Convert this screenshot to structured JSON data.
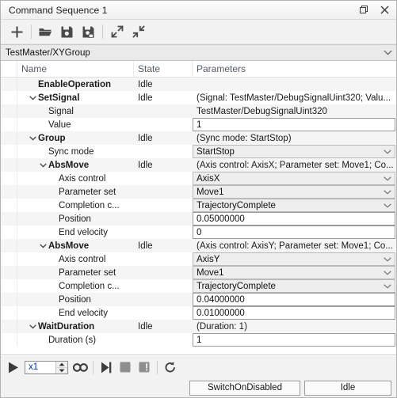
{
  "window": {
    "title": "Command Sequence 1",
    "restore_icon": "restore-window-icon",
    "close_icon": "close-icon"
  },
  "toolbar": {
    "buttons": [
      {
        "name": "add-command-button",
        "icon": "plus-icon",
        "label": "Add"
      },
      {
        "name": "open-sequence-button",
        "icon": "folder-open-icon",
        "label": "Open"
      },
      {
        "name": "save-sequence-button",
        "icon": "save-icon",
        "label": "Save"
      },
      {
        "name": "save-as-sequence-button",
        "icon": "save-as-icon",
        "label": "Save As"
      },
      {
        "name": "expand-all-button",
        "icon": "expand-arrows-icon",
        "label": "Expand All"
      },
      {
        "name": "collapse-all-button",
        "icon": "collapse-arrows-icon",
        "label": "Collapse All"
      }
    ]
  },
  "pathbar": {
    "value": "TestMaster/XYGroup",
    "chevron_icon": "chevron-down-icon"
  },
  "table": {
    "headers": [
      "Name",
      "State",
      "Parameters"
    ],
    "rows": [
      {
        "name": "EnableOperation",
        "indent": 0,
        "bold": true,
        "expander": "none",
        "state": "Idle",
        "param_kind": "text",
        "param": ""
      },
      {
        "name": "SetSignal",
        "indent": 0,
        "bold": true,
        "expander": "expanded",
        "state": "Idle",
        "param_kind": "text",
        "param": "(Signal: TestMaster/DebugSignalUint320; Valu..."
      },
      {
        "name": "Signal",
        "indent": 1,
        "bold": false,
        "expander": "none",
        "state": "",
        "param_kind": "text",
        "param": "TestMaster/DebugSignalUint320"
      },
      {
        "name": "Value",
        "indent": 1,
        "bold": false,
        "expander": "none",
        "state": "",
        "param_kind": "input",
        "param": "1"
      },
      {
        "name": "Group",
        "indent": 0,
        "bold": true,
        "expander": "expanded",
        "state": "Idle",
        "param_kind": "text",
        "param": "(Sync mode: StartStop)"
      },
      {
        "name": "Sync mode",
        "indent": 1,
        "bold": false,
        "expander": "none",
        "state": "",
        "param_kind": "combo",
        "param": "StartStop"
      },
      {
        "name": "AbsMove",
        "indent": 1,
        "bold": true,
        "expander": "expanded",
        "state": "Idle",
        "param_kind": "text",
        "param": "(Axis control: AxisX; Parameter set: Move1; Co..."
      },
      {
        "name": "Axis control",
        "indent": 2,
        "bold": false,
        "expander": "none",
        "state": "",
        "param_kind": "combo",
        "param": "AxisX"
      },
      {
        "name": "Parameter set",
        "indent": 2,
        "bold": false,
        "expander": "none",
        "state": "",
        "param_kind": "combo",
        "param": "Move1"
      },
      {
        "name": "Completion c...",
        "indent": 2,
        "bold": false,
        "expander": "none",
        "state": "",
        "param_kind": "combo",
        "param": "TrajectoryComplete"
      },
      {
        "name": "Position",
        "indent": 2,
        "bold": false,
        "expander": "none",
        "state": "",
        "param_kind": "input",
        "param": "0.05000000"
      },
      {
        "name": "End velocity",
        "indent": 2,
        "bold": false,
        "expander": "none",
        "state": "",
        "param_kind": "input",
        "param": "0"
      },
      {
        "name": "AbsMove",
        "indent": 1,
        "bold": true,
        "expander": "expanded",
        "state": "Idle",
        "param_kind": "text",
        "param": "(Axis control: AxisY; Parameter set: Move1; Co..."
      },
      {
        "name": "Axis control",
        "indent": 2,
        "bold": false,
        "expander": "none",
        "state": "",
        "param_kind": "combo",
        "param": "AxisY"
      },
      {
        "name": "Parameter set",
        "indent": 2,
        "bold": false,
        "expander": "none",
        "state": "",
        "param_kind": "combo",
        "param": "Move1"
      },
      {
        "name": "Completion c...",
        "indent": 2,
        "bold": false,
        "expander": "none",
        "state": "",
        "param_kind": "combo",
        "param": "TrajectoryComplete"
      },
      {
        "name": "Position",
        "indent": 2,
        "bold": false,
        "expander": "none",
        "state": "",
        "param_kind": "input",
        "param": "0.04000000"
      },
      {
        "name": "End velocity",
        "indent": 2,
        "bold": false,
        "expander": "none",
        "state": "",
        "param_kind": "input",
        "param": "0.01000000"
      },
      {
        "name": "WaitDuration",
        "indent": 0,
        "bold": true,
        "expander": "expanded",
        "state": "Idle",
        "param_kind": "text",
        "param": "(Duration: 1)"
      },
      {
        "name": "Duration (s)",
        "indent": 1,
        "bold": false,
        "expander": "none",
        "state": "",
        "param_kind": "input",
        "param": "1"
      }
    ]
  },
  "playbar": {
    "play": {
      "name": "play-button",
      "icon": "play-icon"
    },
    "speed": {
      "name": "speed-stepper",
      "value": "x1",
      "up_icon": "caret-up-icon",
      "down_icon": "caret-down-icon"
    },
    "loop": {
      "name": "loop-button",
      "icon": "infinity-icon"
    },
    "step": {
      "name": "step-button",
      "icon": "step-forward-icon"
    },
    "stop": {
      "name": "stop-button",
      "icon": "stop-square-icon"
    },
    "pause_break": {
      "name": "break-button",
      "icon": "break-square-icon"
    },
    "reset": {
      "name": "reset-button",
      "icon": "reset-arrow-icon"
    }
  },
  "statusbar": {
    "drive_state": "SwitchOnDisabled",
    "sequence_state": "Idle"
  }
}
